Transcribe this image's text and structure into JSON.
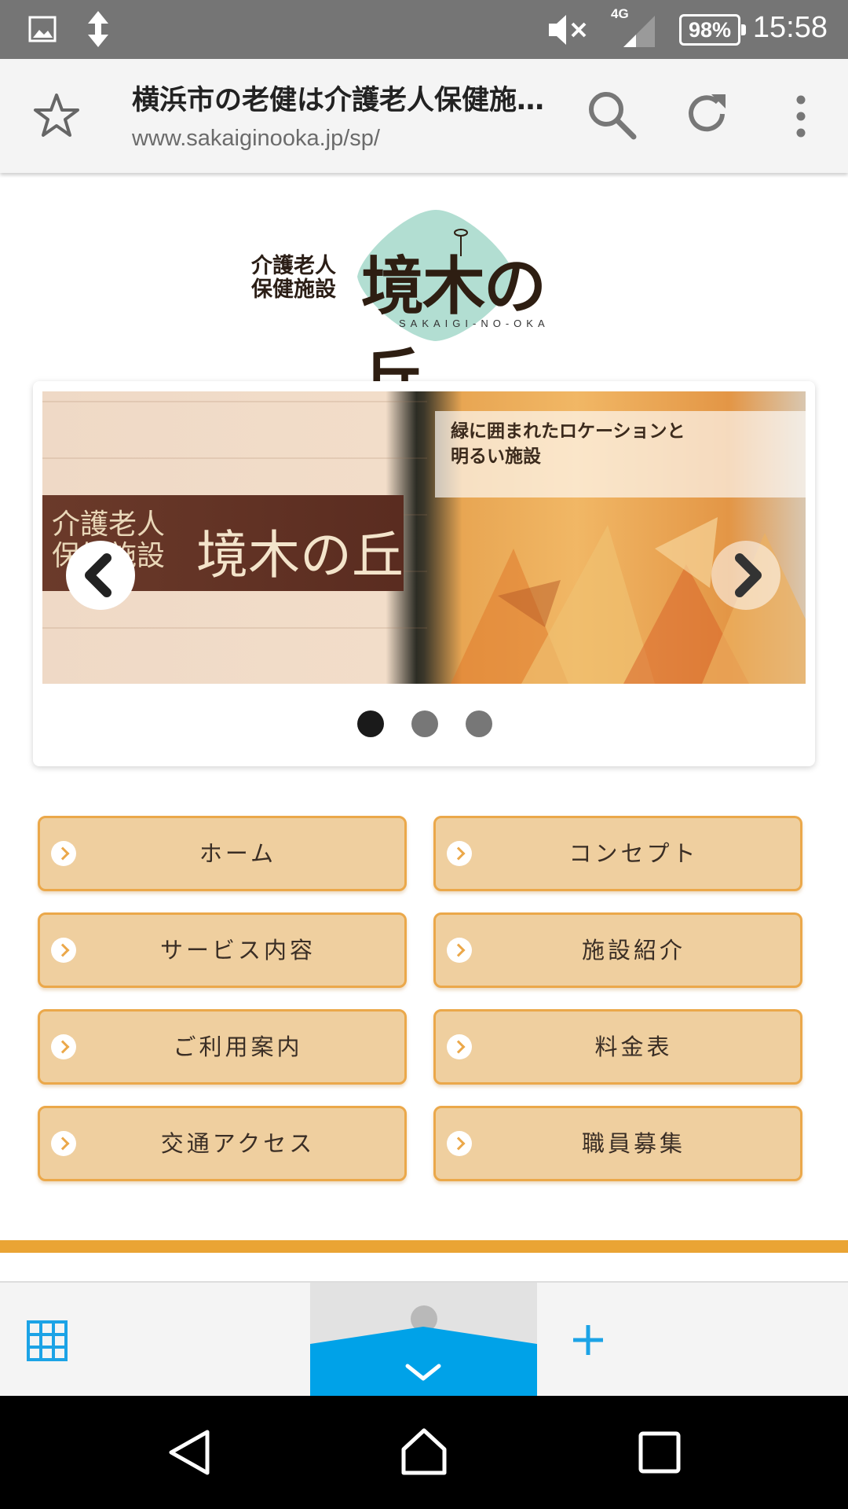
{
  "status_bar": {
    "time": "15:58",
    "battery": "98%",
    "network": "4G",
    "icons": [
      "image-icon",
      "data-transfer-icon",
      "mute-icon",
      "signal-icon",
      "battery-icon"
    ]
  },
  "browser": {
    "page_title": "横浜市の老健は介護老人保健施設…",
    "url": "www.sakaiginooka.jp/sp/",
    "icons": [
      "star-icon",
      "search-icon",
      "reload-icon",
      "more-vert-icon"
    ]
  },
  "logo": {
    "small_line1": "介護老人",
    "small_line2": "保健施設",
    "name": "境木の丘",
    "roman": "SAKAIGI-NO-OKA",
    "accent_color": "#b2ded2"
  },
  "carousel": {
    "sign_small_line1": "介護老人",
    "sign_small_line2": "保健施設",
    "sign_name": "境木の丘",
    "caption": "緑に囲まれたロケーションと\n明るい施設",
    "active_index": 0,
    "dots": 3
  },
  "nav": {
    "items": [
      {
        "label": "ホーム"
      },
      {
        "label": "コンセプト"
      },
      {
        "label": "サービス内容"
      },
      {
        "label": "施設紹介"
      },
      {
        "label": "ご利用案内"
      },
      {
        "label": "料金表"
      },
      {
        "label": "交通アクセス"
      },
      {
        "label": "職員募集"
      }
    ]
  },
  "colors": {
    "nav_fill": "#efcf9f",
    "nav_border": "#eba84a",
    "accent_line": "#eaa434",
    "tab_blue": "#00a2e8"
  },
  "bottom_bar": {
    "icons": [
      "grid-icon",
      "collapse-chevron-icon",
      "add-tab-icon"
    ]
  },
  "system_nav": {
    "icons": [
      "back-icon",
      "home-icon",
      "recents-icon"
    ]
  }
}
